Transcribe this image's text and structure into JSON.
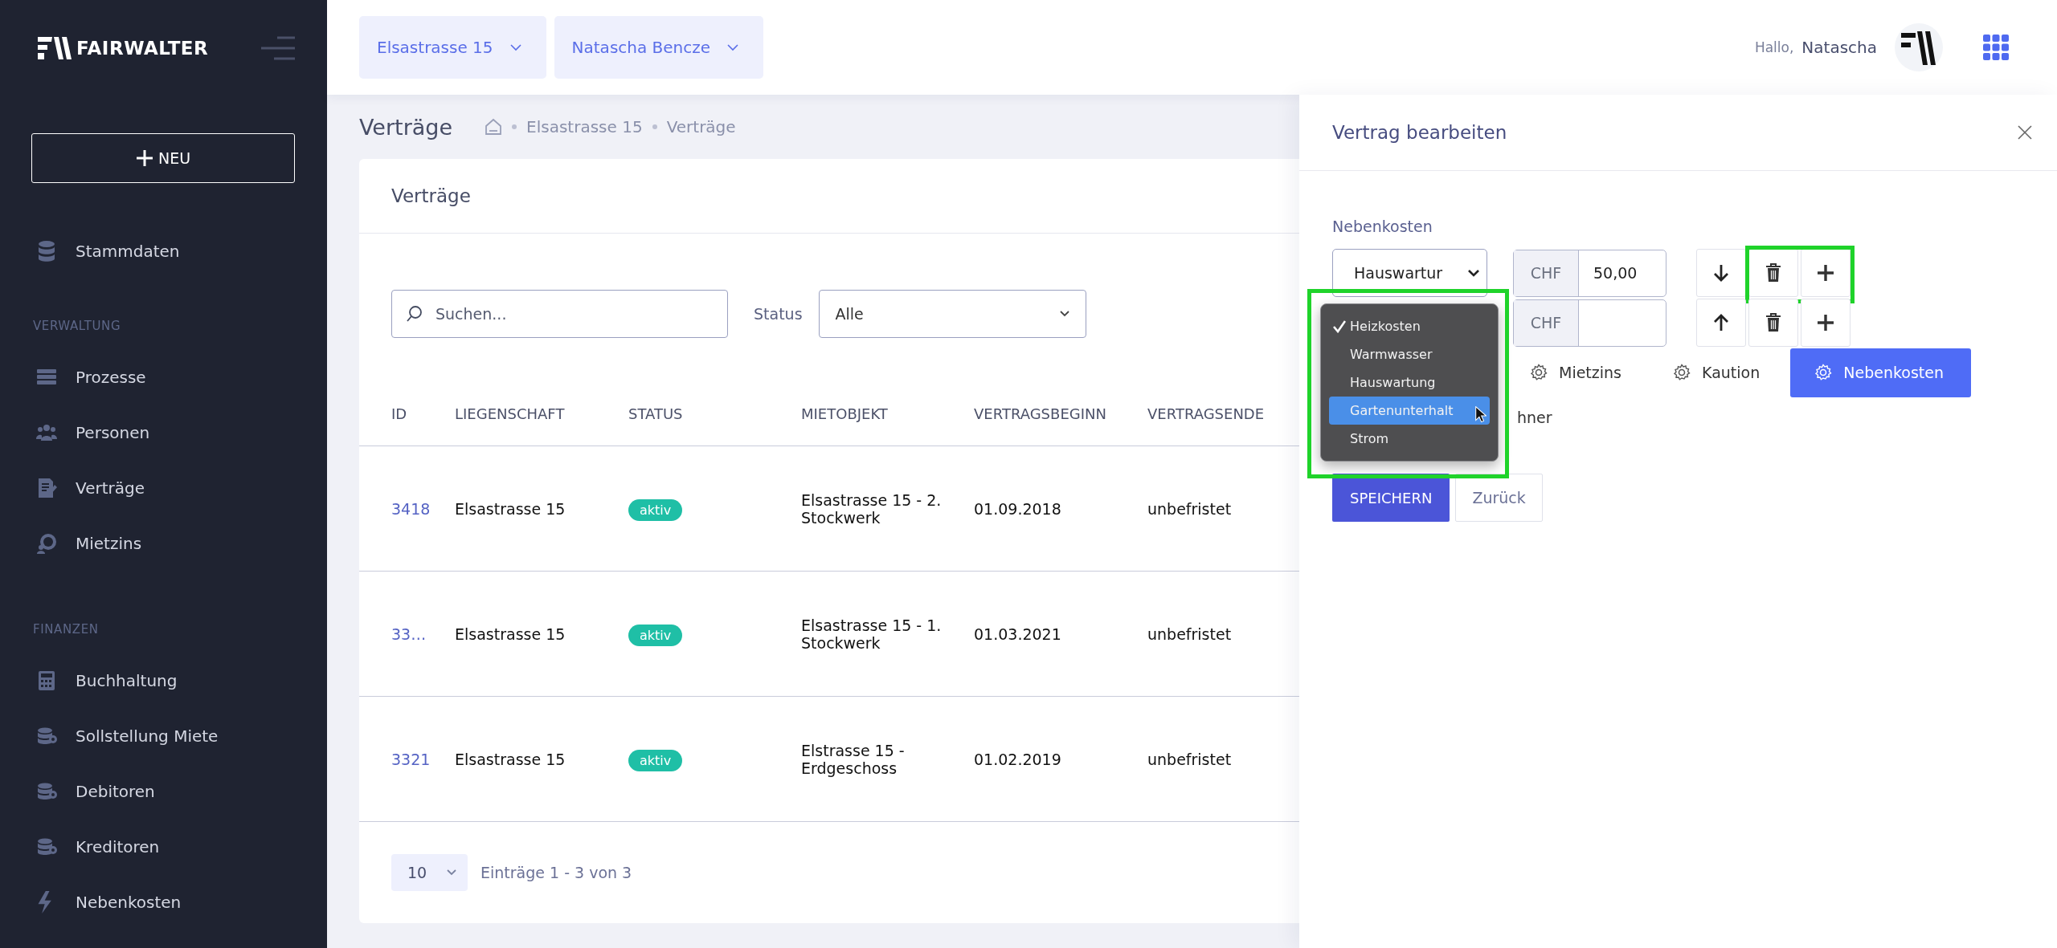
{
  "sidebar": {
    "logo": "FAIRWALTER",
    "new_button": "NEU",
    "sections": [
      {
        "items": [
          {
            "label": "Stammdaten"
          }
        ]
      },
      {
        "title": "VERWALTUNG",
        "items": [
          {
            "label": "Prozesse"
          },
          {
            "label": "Personen"
          },
          {
            "label": "Verträge"
          },
          {
            "label": "Mietzins"
          }
        ]
      },
      {
        "title": "FINANZEN",
        "items": [
          {
            "label": "Buchhaltung"
          },
          {
            "label": "Sollstellung Miete"
          },
          {
            "label": "Debitoren"
          },
          {
            "label": "Kreditoren"
          },
          {
            "label": "Nebenkosten"
          }
        ]
      }
    ]
  },
  "header": {
    "property_select": "Elsastrasse 15",
    "person_select": "Natascha Bencze",
    "greeting": "Hallo,",
    "user_name": "Natascha"
  },
  "page": {
    "title": "Verträge",
    "breadcrumb": [
      "Elsastrasse 15",
      "Verträge"
    ]
  },
  "card": {
    "title": "Verträge",
    "search": {
      "placeholder": "Suchen..."
    },
    "status_filter": {
      "label": "Status",
      "value": "Alle"
    },
    "table": {
      "columns": [
        "ID",
        "LIEGENSCHAFT",
        "STATUS",
        "MIETOBJEKT",
        "VERTRAGSBEGINN",
        "VERTRAGSENDE"
      ],
      "rows": [
        {
          "id": "3418",
          "property": "Elsastrasse 15",
          "status": "aktiv",
          "unit": "Elsastrasse 15 - 2. Stockwerk",
          "start": "01.09.2018",
          "end": "unbefristet"
        },
        {
          "id": "33…",
          "property": "Elsastrasse 15",
          "status": "aktiv",
          "unit": "Elsastrasse 15 - 1. Stockwerk",
          "start": "01.03.2021",
          "end": "unbefristet"
        },
        {
          "id": "3321",
          "property": "Elsastrasse 15",
          "status": "aktiv",
          "unit": "Elstrasse 15 - Erdgeschoss",
          "start": "01.02.2019",
          "end": "unbefristet"
        }
      ]
    },
    "footer": {
      "page_size": "10",
      "summary": "Einträge 1 - 3 von 3"
    }
  },
  "panel": {
    "title": "Vertrag bearbeiten",
    "section_label": "Nebenkosten",
    "cost_rows": [
      {
        "type": "Hauswartur",
        "currency": "CHF",
        "amount": "50,00",
        "kind": "down",
        "highlighted_actions": true
      },
      {
        "currency": "CHF",
        "kind": "up",
        "highlighted_actions": false
      }
    ],
    "dropdown": {
      "highlighted_frame": true,
      "options": [
        {
          "label": "Heizkosten",
          "selected": true,
          "hovered": false
        },
        {
          "label": "Warmwasser",
          "selected": false,
          "hovered": false
        },
        {
          "label": "Hauswartung",
          "selected": false,
          "hovered": false
        },
        {
          "label": "Gartenunterhalt",
          "selected": false,
          "hovered": true
        },
        {
          "label": "Strom",
          "selected": false,
          "hovered": false
        }
      ]
    },
    "tabs": [
      {
        "label": "Mietzins",
        "selected": false
      },
      {
        "label": "Kaution",
        "selected": false
      },
      {
        "label": "Nebenkosten",
        "selected": true
      }
    ],
    "partial_text": "hner",
    "save_button": "SPEICHERN",
    "back_button": "Zurück"
  }
}
